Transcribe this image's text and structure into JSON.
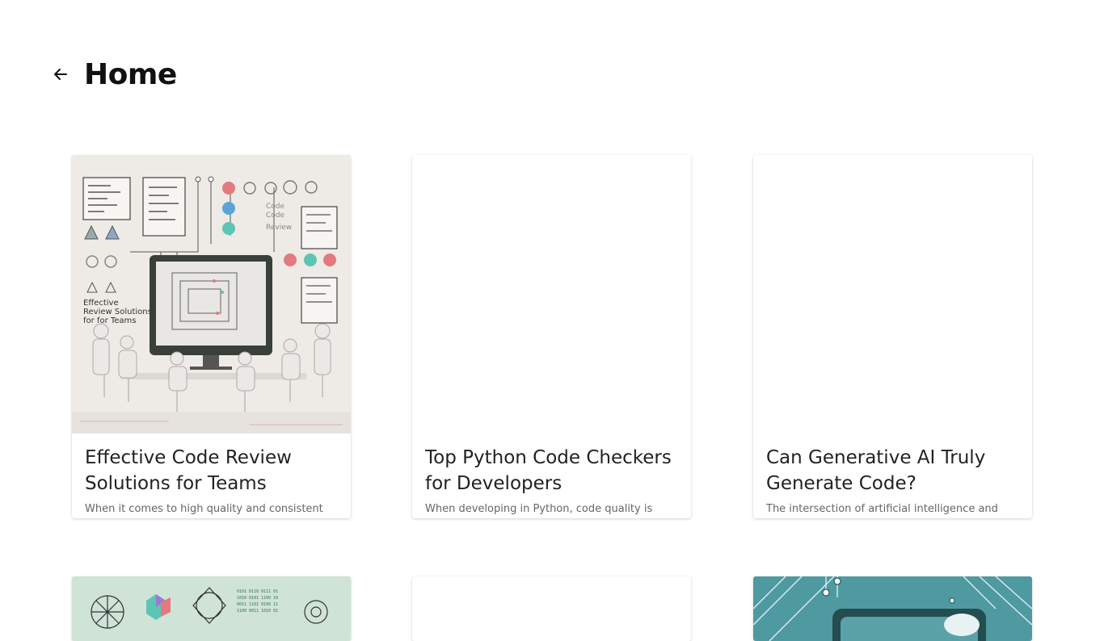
{
  "header": {
    "title": "Home",
    "back_icon": "arrow-left-icon"
  },
  "cards": [
    {
      "title": "Effective Code Review Solutions for Teams",
      "excerpt": "When it comes to high quality and consistent",
      "image_caption": "Effective Review Solutions for Teams",
      "image_side_text": [
        "Code",
        "Code",
        "Review"
      ]
    },
    {
      "title": "Top Python Code Checkers for Developers",
      "excerpt": "When developing in Python, code quality is"
    },
    {
      "title": "Can Generative AI Truly Generate Code?",
      "excerpt": "The intersection of artificial intelligence and"
    }
  ],
  "colors": {
    "accent_red": "#e27a7f",
    "accent_blue": "#5aa5d6",
    "accent_teal": "#5cc5b3",
    "teal_panel": "#3e8f95"
  }
}
